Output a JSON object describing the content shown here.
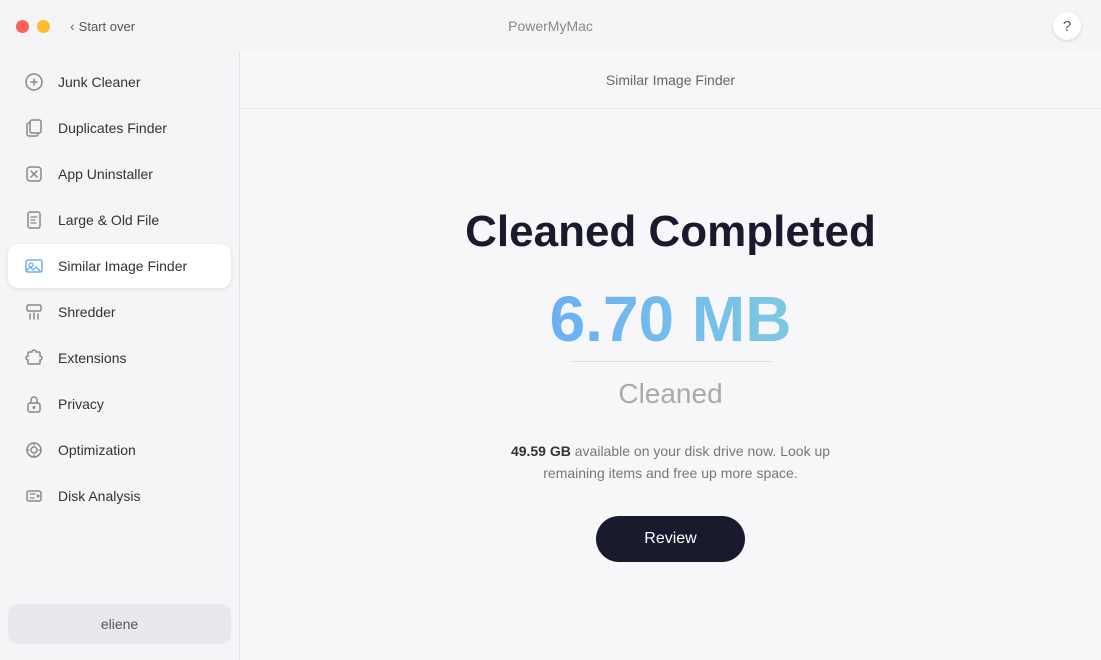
{
  "titlebar": {
    "app_name": "PowerMyMac",
    "start_over": "Start over",
    "help_label": "?"
  },
  "header": {
    "title": "Similar Image Finder"
  },
  "sidebar": {
    "items": [
      {
        "id": "junk-cleaner",
        "label": "Junk Cleaner",
        "icon": "⚙"
      },
      {
        "id": "duplicates-finder",
        "label": "Duplicates Finder",
        "icon": "▤"
      },
      {
        "id": "app-uninstaller",
        "label": "App Uninstaller",
        "icon": "⊘"
      },
      {
        "id": "large-old-file",
        "label": "Large & Old File",
        "icon": "🗂"
      },
      {
        "id": "similar-image-finder",
        "label": "Similar Image Finder",
        "icon": "🖼",
        "active": true
      },
      {
        "id": "shredder",
        "label": "Shredder",
        "icon": "▦"
      },
      {
        "id": "extensions",
        "label": "Extensions",
        "icon": "⚙"
      },
      {
        "id": "privacy",
        "label": "Privacy",
        "icon": "🔒"
      },
      {
        "id": "optimization",
        "label": "Optimization",
        "icon": "◎"
      },
      {
        "id": "disk-analysis",
        "label": "Disk Analysis",
        "icon": "▬"
      }
    ],
    "footer_label": "eliene"
  },
  "content": {
    "cleaned_title": "Cleaned Completed",
    "cleaned_size": "6.70 MB",
    "cleaned_label": "Cleaned",
    "disk_size": "49.59 GB",
    "disk_message": " available on your disk drive now. Look up remaining items and free up more space.",
    "review_button": "Review"
  }
}
